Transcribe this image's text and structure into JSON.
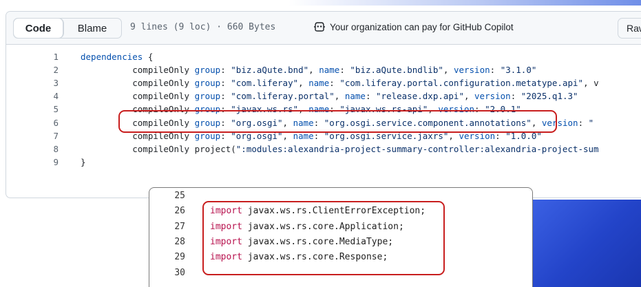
{
  "header": {
    "tabs": [
      {
        "label": "Code",
        "active": true
      },
      {
        "label": "Blame",
        "active": false
      }
    ],
    "file_meta": "9 lines (9 loc) · 660 Bytes",
    "copilot_text": "Your organization can pay for GitHub Copilot",
    "raw_label": "Raw"
  },
  "code_lines": [
    {
      "n": "1",
      "text": "dependencies {"
    },
    {
      "n": "2",
      "text": "\tcompileOnly group: \"biz.aQute.bnd\", name: \"biz.aQute.bndlib\", version: \"3.1.0\""
    },
    {
      "n": "3",
      "text": "\tcompileOnly group: \"com.liferay\", name: \"com.liferay.portal.configuration.metatype.api\", v"
    },
    {
      "n": "4",
      "text": "\tcompileOnly group: \"com.liferay.portal\", name: \"release.dxp.api\", version: \"2025.q1.3\""
    },
    {
      "n": "5",
      "text": "\tcompileOnly group: \"javax.ws.rs\", name: \"javax.ws.rs-api\", version: \"2.0.1\""
    },
    {
      "n": "6",
      "text": "\tcompileOnly group: \"org.osgi\", name: \"org.osgi.service.component.annotations\", version: \""
    },
    {
      "n": "7",
      "text": "\tcompileOnly group: \"org.osgi\", name: \"org.osgi.service.jaxrs\", version: \"1.0.0\""
    },
    {
      "n": "8",
      "text": "\tcompileOnly project(\":modules:alexandria-project-summary-controller:alexandria-project-sum"
    },
    {
      "n": "9",
      "text": "}"
    }
  ],
  "import_lines": [
    {
      "n": "25",
      "keyword": "",
      "text": ""
    },
    {
      "n": "26",
      "keyword": "import",
      "text": " javax.ws.rs.ClientErrorException;"
    },
    {
      "n": "27",
      "keyword": "import",
      "text": " javax.ws.rs.core.Application;"
    },
    {
      "n": "28",
      "keyword": "import",
      "text": " javax.ws.rs.core.MediaType;"
    },
    {
      "n": "29",
      "keyword": "import",
      "text": " javax.ws.rs.core.Response;"
    },
    {
      "n": "30",
      "keyword": "",
      "text": ""
    }
  ],
  "colors": {
    "highlight_border": "#c81e1e",
    "keyword": "#0550ae",
    "string": "#0a3069",
    "import_keyword": "#b8134f"
  },
  "icons": [
    "copilot-icon"
  ]
}
